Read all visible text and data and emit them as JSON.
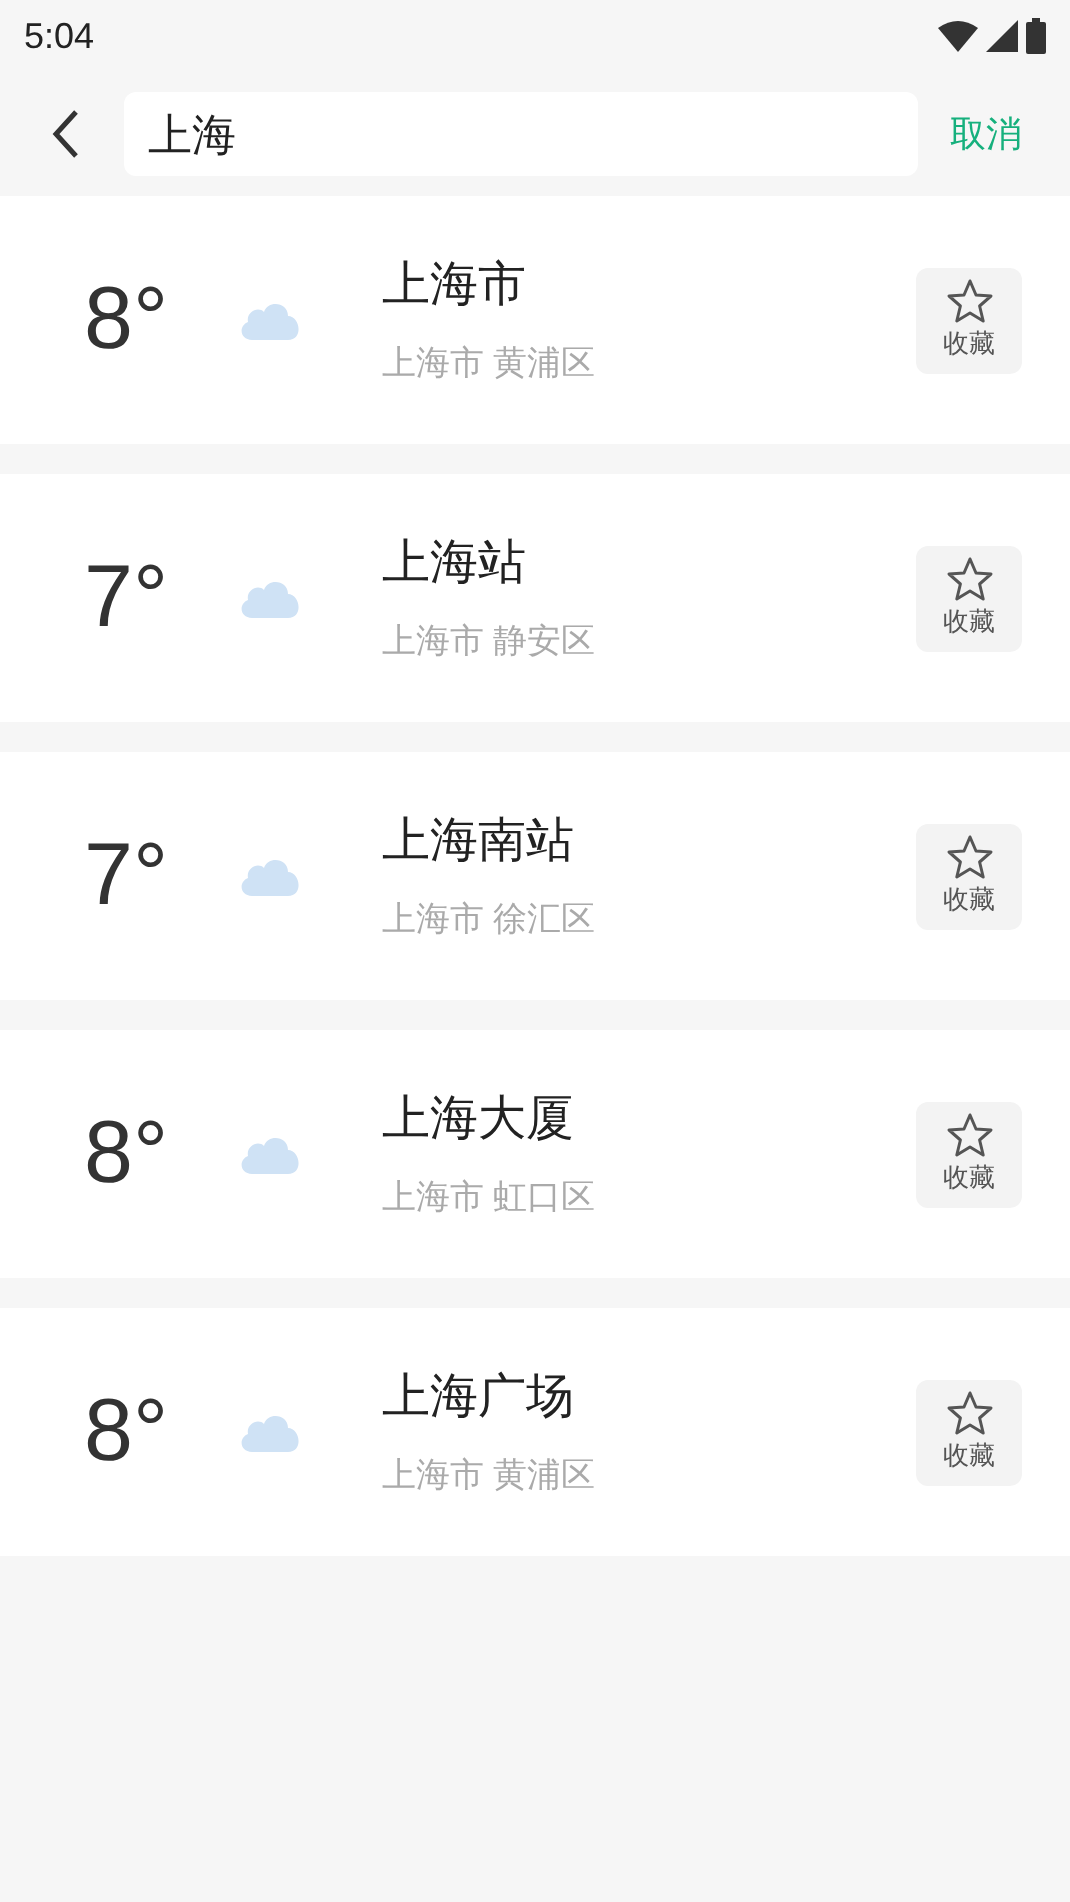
{
  "status_bar": {
    "time": "5:04"
  },
  "search": {
    "value": "上海",
    "cancel": "取消"
  },
  "results": [
    {
      "temperature": "8°",
      "name": "上海市",
      "location": "上海市 黄浦区",
      "favorite_label": "收藏"
    },
    {
      "temperature": "7°",
      "name": "上海站",
      "location": "上海市 静安区",
      "favorite_label": "收藏"
    },
    {
      "temperature": "7°",
      "name": "上海南站",
      "location": "上海市 徐汇区",
      "favorite_label": "收藏"
    },
    {
      "temperature": "8°",
      "name": "上海大厦",
      "location": "上海市 虹口区",
      "favorite_label": "收藏"
    },
    {
      "temperature": "8°",
      "name": "上海广场",
      "location": "上海市 黄浦区",
      "favorite_label": "收藏"
    }
  ]
}
